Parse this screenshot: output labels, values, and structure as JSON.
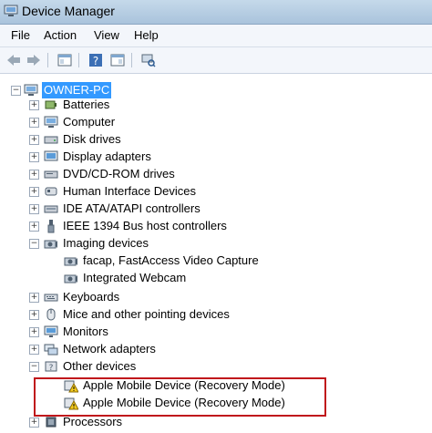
{
  "window": {
    "title": "Device Manager"
  },
  "menu": {
    "file": "File",
    "action": "Action",
    "view": "View",
    "help": "Help"
  },
  "tree": {
    "root": "OWNER-PC",
    "batteries": "Batteries",
    "computer": "Computer",
    "disk_drives": "Disk drives",
    "display_adapters": "Display adapters",
    "dvd": "DVD/CD-ROM drives",
    "hid": "Human Interface Devices",
    "ide": "IDE ATA/ATAPI controllers",
    "ieee": "IEEE 1394 Bus host controllers",
    "imaging": "Imaging devices",
    "imaging_children": [
      "facap, FastAccess Video Capture",
      "Integrated Webcam"
    ],
    "keyboards": "Keyboards",
    "mice": "Mice and other pointing devices",
    "monitors": "Monitors",
    "network": "Network adapters",
    "other": "Other devices",
    "other_children": [
      "Apple Mobile Device (Recovery Mode)",
      "Apple Mobile Device (Recovery Mode)"
    ],
    "processors": "Processors"
  },
  "colors": {
    "highlight_box": "#c0151b",
    "selection": "#3399ff"
  }
}
